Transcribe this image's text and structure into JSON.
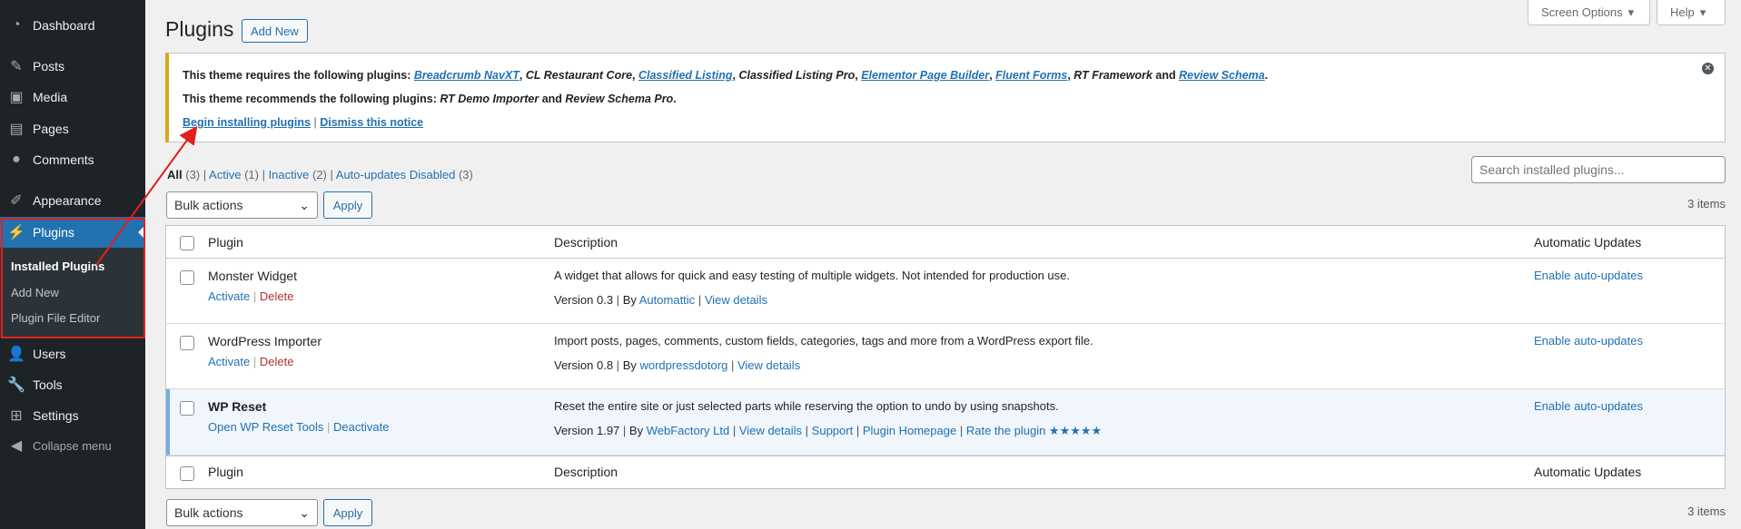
{
  "sidebar": {
    "items": [
      {
        "label": "Dashboard",
        "icon": "dashboard-icon"
      },
      {
        "label": "Posts",
        "icon": "pin-icon"
      },
      {
        "label": "Media",
        "icon": "media-icon"
      },
      {
        "label": "Pages",
        "icon": "pages-icon"
      },
      {
        "label": "Comments",
        "icon": "comment-icon"
      },
      {
        "label": "Appearance",
        "icon": "brush-icon"
      },
      {
        "label": "Plugins",
        "icon": "plugin-icon"
      },
      {
        "label": "Users",
        "icon": "user-icon"
      },
      {
        "label": "Tools",
        "icon": "wrench-icon"
      },
      {
        "label": "Settings",
        "icon": "settings-icon"
      }
    ],
    "submenu": [
      "Installed Plugins",
      "Add New",
      "Plugin File Editor"
    ],
    "collapse": "Collapse menu"
  },
  "header": {
    "title": "Plugins",
    "add_new": "Add New",
    "screen_options": "Screen Options",
    "help": "Help"
  },
  "notice": {
    "requires_prefix": "This theme requires the following plugins:",
    "required": [
      "Breadcrumb NavXT",
      "CL Restaurant Core",
      "Classified Listing",
      "Classified Listing Pro",
      "Elementor Page Builder",
      "Fluent Forms",
      "RT Framework",
      "Review Schema"
    ],
    "recommends_prefix": "This theme recommends the following plugins:",
    "recommended": [
      "RT Demo Importer",
      "Review Schema Pro"
    ],
    "and": "and",
    "begin_installing": "Begin installing plugins",
    "dismiss": "Dismiss this notice",
    "separator": "|"
  },
  "filters": {
    "all": "All",
    "all_count": "(3)",
    "active": "Active",
    "active_count": "(1)",
    "inactive": "Inactive",
    "inactive_count": "(2)",
    "auto_disabled": "Auto-updates Disabled",
    "auto_disabled_count": "(3)"
  },
  "search": {
    "placeholder": "Search installed plugins..."
  },
  "bulk": {
    "label": "Bulk actions",
    "apply": "Apply",
    "count": "3 items"
  },
  "table": {
    "columns": [
      "Plugin",
      "Description",
      "Automatic Updates"
    ],
    "rows": [
      {
        "name": "Monster Widget",
        "actions": [
          "Activate",
          "Delete"
        ],
        "description": "A widget that allows for quick and easy testing of multiple widgets. Not intended for production use.",
        "version": "Version 0.3",
        "by": "By",
        "author": "Automattic",
        "links": [
          "View details"
        ],
        "auto": "Enable auto-updates"
      },
      {
        "name": "WordPress Importer",
        "actions": [
          "Activate",
          "Delete"
        ],
        "description": "Import posts, pages, comments, custom fields, categories, tags and more from a WordPress export file.",
        "version": "Version 0.8",
        "by": "By",
        "author": "wordpressdotorg",
        "links": [
          "View details"
        ],
        "auto": "Enable auto-updates"
      },
      {
        "name": "WP Reset",
        "actions": [
          "Open WP Reset Tools",
          "Deactivate"
        ],
        "description": "Reset the entire site or just selected parts while reserving the option to undo by using snapshots.",
        "version": "Version 1.97",
        "by": "By",
        "author": "WebFactory Ltd",
        "links": [
          "View details",
          "Support",
          "Plugin Homepage",
          "Rate the plugin ★★★★★"
        ],
        "auto": "Enable auto-updates"
      }
    ]
  },
  "colors": {
    "accent": "#2271b1",
    "sidebar": "#1d2327",
    "notice_border": "#dba617",
    "highlight": "#e0201d"
  }
}
